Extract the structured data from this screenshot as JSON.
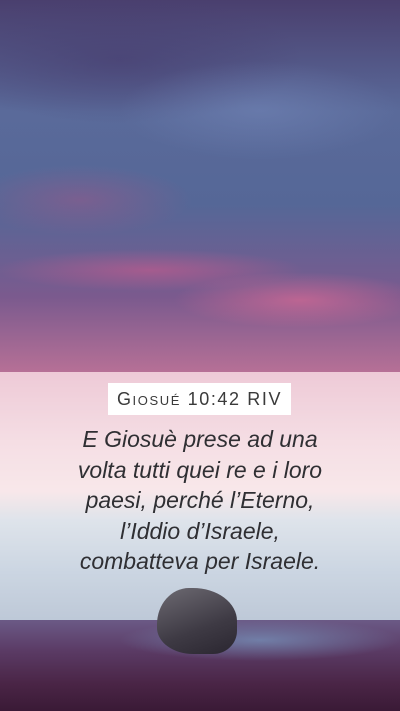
{
  "reference": "Giosué 10:42 RIV",
  "verse_text": "E Giosuè prese ad una\nvolta tutti quei re e i loro\npaesi, perché l’Eterno,\nl’Iddio d’Israele,\ncombatteva per Israele.",
  "background_image": "sunset-sea-rock-photo",
  "colors": {
    "reference_box": "#ffffff",
    "reference_text": "#3a3a3a",
    "verse_text": "#2f2f33"
  }
}
